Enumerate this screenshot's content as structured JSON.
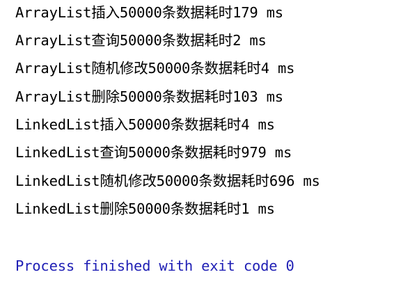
{
  "console": {
    "lines": [
      "ArrayList插入50000条数据耗时179 ms",
      "ArrayList查询50000条数据耗时2 ms",
      "ArrayList随机修改50000条数据耗时4 ms",
      "ArrayList删除50000条数据耗时103 ms",
      "LinkedList插入50000条数据耗时4 ms",
      "LinkedList查询50000条数据耗时979 ms",
      "LinkedList随机修改50000条数据耗时696 ms",
      "LinkedList删除50000条数据耗时1 ms"
    ],
    "exit_message": "Process finished with exit code 0"
  },
  "colors": {
    "text": "#000000",
    "exit_text": "#1f1fb5",
    "background": "#ffffff"
  }
}
